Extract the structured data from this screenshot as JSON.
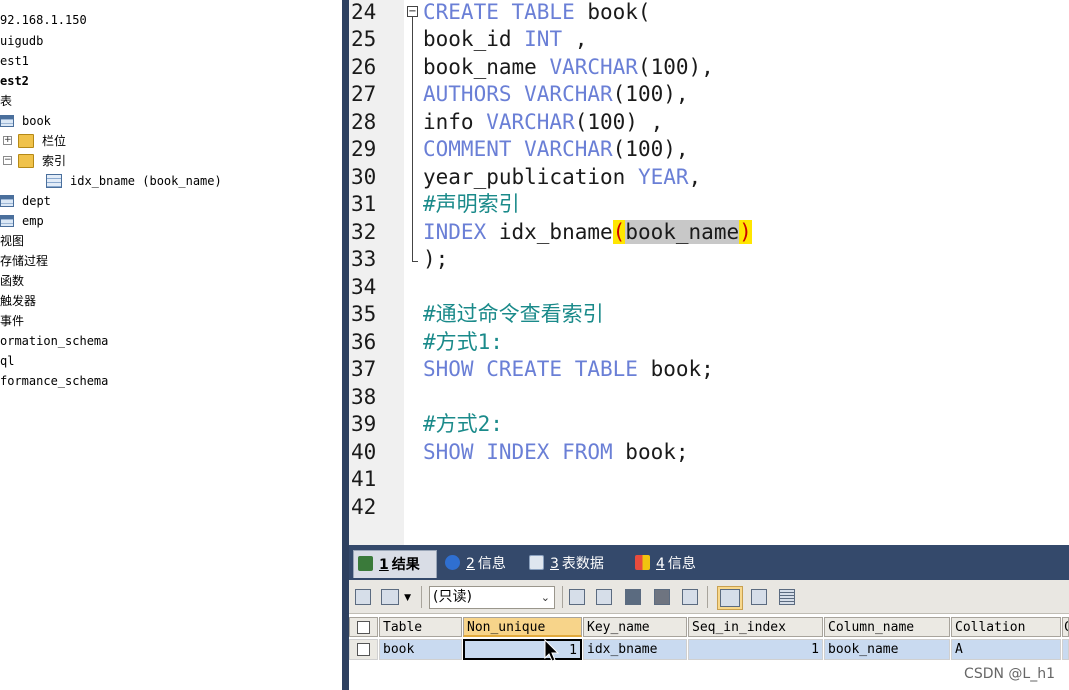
{
  "tree": {
    "items": [
      {
        "label": "92.168.1.150",
        "bold": false
      },
      {
        "label": "uigudb",
        "bold": false
      },
      {
        "label": "est1",
        "bold": false
      },
      {
        "label": "est2",
        "bold": true
      },
      {
        "label": "表",
        "bold": false
      },
      {
        "label": "book",
        "icon": "table-icon"
      },
      {
        "label": "栏位",
        "icon": "folder-icon",
        "expander": "+"
      },
      {
        "label": "索引",
        "icon": "folder-icon",
        "expander": "−"
      },
      {
        "label": "idx_bname (book_name)",
        "icon": "index-icon"
      },
      {
        "label": "dept",
        "icon": "table-icon"
      },
      {
        "label": "emp",
        "icon": "table-icon"
      },
      {
        "label": "视图"
      },
      {
        "label": "存储过程"
      },
      {
        "label": "函数"
      },
      {
        "label": "触发器"
      },
      {
        "label": "事件"
      },
      {
        "label": "ormation_schema"
      },
      {
        "label": "ql"
      },
      {
        "label": "formance_schema"
      }
    ]
  },
  "editor": {
    "line_numbers": [
      "24",
      "25",
      "26",
      "27",
      "28",
      "29",
      "30",
      "31",
      "32",
      "33",
      "34",
      "35",
      "36",
      "37",
      "38",
      "39",
      "40",
      "41",
      "42"
    ],
    "lines": {
      "l24": [
        "CREATE TABLE",
        " book("
      ],
      "l25": [
        "book_id ",
        "INT",
        " ,"
      ],
      "l26": [
        "book_name ",
        "VARCHAR",
        "(100),"
      ],
      "l27": [
        "AUTHORS VARCHAR",
        "(100),"
      ],
      "l28": [
        "info ",
        "VARCHAR",
        "(100) ,"
      ],
      "l29": [
        "COMMENT VARCHAR",
        "(100),"
      ],
      "l30": [
        "year_publication ",
        "YEAR",
        ","
      ],
      "l31": "#声明索引",
      "l32": [
        "INDEX",
        " idx_bname",
        "(",
        "book_name",
        ")"
      ],
      "l33": ");",
      "l35": "#通过命令查看索引",
      "l36": "#方式1:",
      "l37": [
        "SHOW CREATE TABLE",
        " book;"
      ],
      "l39": "#方式2:",
      "l40": [
        "SHOW INDEX FROM",
        " book;"
      ]
    },
    "fold_marker": "−"
  },
  "results": {
    "tabs": [
      {
        "num": "1",
        "label": "结果"
      },
      {
        "num": "2",
        "label": "信息"
      },
      {
        "num": "3",
        "label": "表数据"
      },
      {
        "num": "4",
        "label": "信息"
      }
    ],
    "mode_select": "(只读)",
    "mode_arrow": "⌄",
    "columns": [
      "Table",
      "Non_unique",
      "Key_name",
      "Seq_in_index",
      "Column_name",
      "Collation",
      "C"
    ],
    "rows": [
      [
        "book",
        "1",
        "idx_bname",
        "1",
        "book_name",
        "A",
        ""
      ]
    ]
  },
  "watermark": "CSDN @L_h1",
  "colors": {
    "keyword": "#6a7fd6",
    "comment": "#1a8a8a",
    "brace_highlight": "#ffe600",
    "tab_bar": "#34496b"
  }
}
